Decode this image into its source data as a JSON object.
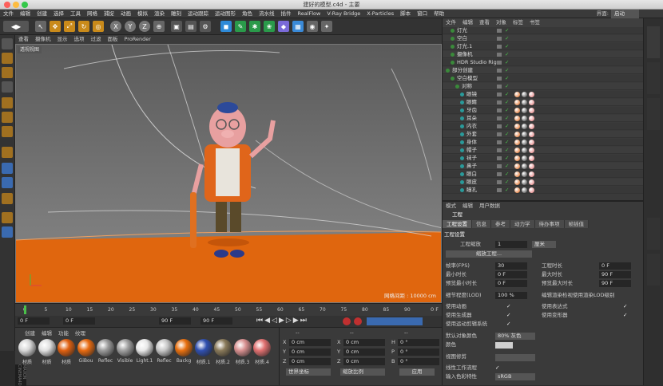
{
  "window": {
    "title": "建好的模型.c4d - 主要"
  },
  "menubar": {
    "items": [
      "文件",
      "编辑",
      "创建",
      "选择",
      "工具",
      "网格",
      "捕捉",
      "动画",
      "模拟",
      "渲染",
      "雕刻",
      "运动跟踪",
      "运动图形",
      "角色",
      "流水线",
      "插件",
      "RealFlow",
      "V-Ray Bridge",
      "X-Particles",
      "脚本",
      "窗口",
      "帮助"
    ],
    "layout_label": "界面:",
    "layout_value": "启动"
  },
  "toolbar": {
    "axis": [
      "X",
      "Y",
      "Z"
    ]
  },
  "viewport": {
    "menu": [
      "查看",
      "摄像机",
      "显示",
      "选项",
      "过滤",
      "面板",
      "ProRender"
    ],
    "mode_label": "透视视图",
    "grid_spacing": "网格间距 : 10000 cm"
  },
  "timeline": {
    "ticks": [
      "0",
      "5",
      "10",
      "15",
      "20",
      "25",
      "30",
      "35",
      "40",
      "45",
      "50",
      "55",
      "60",
      "65",
      "70",
      "75",
      "80",
      "85",
      "90"
    ],
    "end": "0 F"
  },
  "transport": {
    "current": "0 F",
    "start": "0 F",
    "end": "90 F",
    "end2": "90 F"
  },
  "materials": {
    "menu": [
      "创建",
      "编辑",
      "功能",
      "纹理"
    ],
    "items": [
      {
        "name": "材质",
        "color": "#d8d8d8"
      },
      {
        "name": "材质",
        "color": "#e0e0e0"
      },
      {
        "name": "材质",
        "color": "#e06010"
      },
      {
        "name": "GiBou",
        "color": "#e86a10"
      },
      {
        "name": "Reflec",
        "color": "#9a9a9a"
      },
      {
        "name": "Visible",
        "color": "#a0a0a0"
      },
      {
        "name": "Light.1",
        "color": "#e8e8e8"
      },
      {
        "name": "Reflec",
        "color": "#c8c8c8"
      },
      {
        "name": "Backg",
        "color": "#e87010"
      },
      {
        "name": "材质.1",
        "color": "#3050b0"
      },
      {
        "name": "材质.2",
        "color": "#8a7a5a"
      },
      {
        "name": "材质.3",
        "color": "#d89090"
      },
      {
        "name": "材质.4",
        "color": "#e07070"
      }
    ],
    "logo": "MAXON CINEMA4D"
  },
  "coords": {
    "header": [
      "--",
      "--",
      "--"
    ],
    "rows": [
      {
        "axis": "X",
        "val": "0 cm",
        "axis2": "X",
        "val2": "0 cm",
        "axis3": "H",
        "val3": "0 °"
      },
      {
        "axis": "Y",
        "val": "0 cm",
        "axis2": "Y",
        "val2": "0 cm",
        "axis3": "P",
        "val3": "0 °"
      },
      {
        "axis": "Z",
        "val": "0 cm",
        "axis2": "Z",
        "val2": "0 cm",
        "axis3": "B",
        "val3": "0 °"
      }
    ],
    "space": "世界坐标",
    "scale": "缩放比例",
    "apply": "应用"
  },
  "objects": {
    "menu": [
      "文件",
      "编辑",
      "查看",
      "对象",
      "标签",
      "书签"
    ],
    "rows": [
      {
        "name": "灯光",
        "indent": 1
      },
      {
        "name": "空白",
        "indent": 1
      },
      {
        "name": "灯光.1",
        "indent": 1
      },
      {
        "name": "摄像机",
        "indent": 1
      },
      {
        "name": "HDR Studio Rig",
        "indent": 1
      },
      {
        "name": "部分创建",
        "indent": 0
      },
      {
        "name": "空白模型",
        "indent": 1
      },
      {
        "name": "对称",
        "indent": 2
      },
      {
        "name": "眼镜",
        "indent": 3
      },
      {
        "name": "眼睛",
        "indent": 3
      },
      {
        "name": "牙齿",
        "indent": 3
      },
      {
        "name": "耳朵",
        "indent": 3
      },
      {
        "name": "内衣",
        "indent": 3
      },
      {
        "name": "外套",
        "indent": 3
      },
      {
        "name": "身体",
        "indent": 3
      },
      {
        "name": "帽子",
        "indent": 3
      },
      {
        "name": "袜子",
        "indent": 3
      },
      {
        "name": "鼻子",
        "indent": 3
      },
      {
        "name": "眼白",
        "indent": 3
      },
      {
        "name": "眼皮",
        "indent": 3
      },
      {
        "name": "瞳孔",
        "indent": 3
      }
    ]
  },
  "attributes": {
    "menu": [
      "模式",
      "编辑",
      "用户数据"
    ],
    "section": "工程",
    "tabs": [
      "工程设置",
      "信息",
      "参考",
      "动力学",
      "待办事项",
      "帧插值"
    ],
    "group": "工程设置",
    "scale_label": "工程缩放",
    "scale_value": "1",
    "scale_unit": "厘米",
    "scale_btn": "缩放工程...",
    "fps_label": "帧率(FPS)",
    "fps": "30",
    "proj_len_label": "工程时长",
    "proj_len": "0 F",
    "min_label": "最小时长",
    "min": "0 F",
    "max_label": "最大时长",
    "max": "90 F",
    "pmin_label": "预览最小时长",
    "pmin": "0 F",
    "pmax_label": "预览最大时长",
    "pmax": "90 F",
    "lod_label": "细节程度(LOD)",
    "lod": "100 %",
    "lod_note": "编辑渲染检视使用渲染LOD级别",
    "chk1": "使用动画",
    "chk2": "使用表达式",
    "chk3": "使用生成器",
    "chk4": "使用变形器",
    "chk5": "使用运动剪辑系统",
    "defcol_label": "默认对象颜色",
    "defcol": "80% 灰色",
    "color_label": "颜色",
    "view_label": "视图修剪",
    "linear_label": "线性工作流程",
    "input_label": "输入色彩特性",
    "input": "sRGB"
  }
}
